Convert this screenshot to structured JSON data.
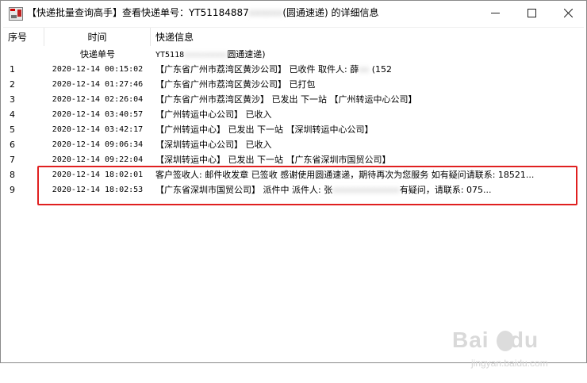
{
  "window": {
    "title_prefix": "【快递批量查询高手】查看快递单号：YT51184887",
    "title_blurred": "xxxxxx",
    "title_suffix": "(圆通速递) 的详细信息"
  },
  "columns": [
    "序号",
    "时间",
    "快递信息"
  ],
  "subheader": {
    "label": "快递单号",
    "number_prefix": "YT5118",
    "number_blurred": "xxxxxxxxx",
    "carrier": "圆通速递)"
  },
  "rows": [
    {
      "seq": "1",
      "time": "2020-12-14 00:15:02",
      "info": "【广东省广州市荔湾区黄沙公司】 已收件 取件人: 薛",
      "info_blur": "xx",
      "info_tail": " (152"
    },
    {
      "seq": "2",
      "time": "2020-12-14 01:27:46",
      "info": "【广东省广州市荔湾区黄沙公司】 已打包",
      "info_blur": "",
      "info_tail": ""
    },
    {
      "seq": "3",
      "time": "2020-12-14 02:26:04",
      "info": "【广东省广州市荔湾区黄沙】 已发出 下一站 【广州转运中心公司】",
      "info_blur": "",
      "info_tail": ""
    },
    {
      "seq": "4",
      "time": "2020-12-14 03:40:57",
      "info": "【广州转运中心公司】 已收入",
      "info_blur": "",
      "info_tail": ""
    },
    {
      "seq": "5",
      "time": "2020-12-14 03:42:17",
      "info": "【广州转运中心】 已发出 下一站 【深圳转运中心公司】",
      "info_blur": "",
      "info_tail": ""
    },
    {
      "seq": "6",
      "time": "2020-12-14 09:06:34",
      "info": "【深圳转运中心公司】 已收入",
      "info_blur": "",
      "info_tail": ""
    },
    {
      "seq": "7",
      "time": "2020-12-14 09:22:04",
      "info": "【深圳转运中心】 已发出 下一站 【广东省深圳市国贸公司】",
      "info_blur": "",
      "info_tail": ""
    },
    {
      "seq": "8",
      "time": "2020-12-14 18:02:01",
      "info": "客户签收人: 邮件收发章 已签收  感谢使用圆通速递，期待再次为您服务 如有疑问请联系: 18521...",
      "info_blur": "",
      "info_tail": ""
    },
    {
      "seq": "9",
      "time": "2020-12-14 18:02:53",
      "info": "【广东省深圳市国贸公司】 派件中  派件人: 张",
      "info_blur": "xxxxxxxxxxxxx",
      "info_tail": "有疑问，请联系: 075..."
    }
  ],
  "watermark": {
    "logo": "Bai  du",
    "sub": "jingyan.baidu.com"
  },
  "colors": {
    "highlight": "#e02020"
  }
}
